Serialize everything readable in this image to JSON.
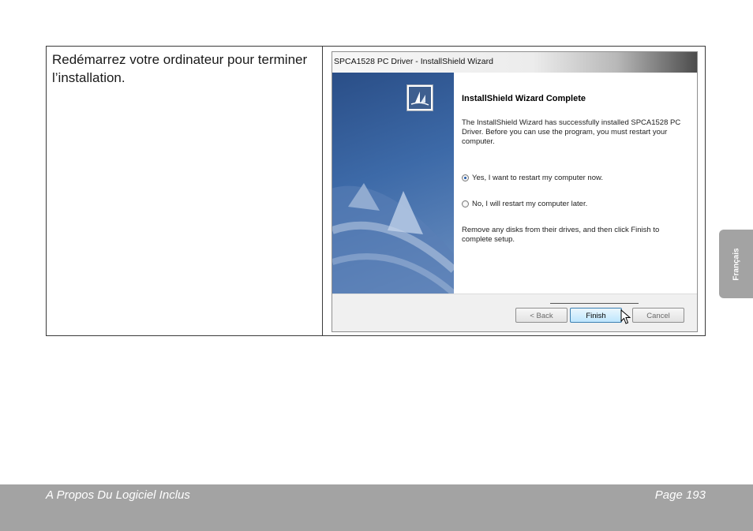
{
  "instruction": {
    "text": "Redémarrez votre ordinateur pour terminer l’installation."
  },
  "wizard": {
    "title": "SPCA1528 PC Driver - InstallShield Wizard",
    "heading": "InstallShield Wizard Complete",
    "body": "The InstallShield Wizard has successfully installed SPCA1528 PC Driver.  Before you can use the program, you must restart your computer.",
    "options": [
      {
        "label": "Yes, I want to restart my computer now.",
        "checked": true
      },
      {
        "label": "No, I will restart my computer later.",
        "checked": false
      }
    ],
    "remove_text": "Remove any disks from their drives, and then click Finish to complete setup.",
    "buttons": {
      "back": "< Back",
      "finish": "Finish",
      "cancel": "Cancel"
    },
    "icons": {
      "logo": "installshield-logo-icon",
      "cursor": "mouse-pointer-icon"
    },
    "colors": {
      "banner": "#2a4e87",
      "finish_border": "#3c7fb1",
      "radio_dot": "#1e57a8"
    }
  },
  "side_tab": {
    "label": "Français"
  },
  "footer": {
    "section": "A Propos Du Logiciel Inclus",
    "page": "Page 193"
  }
}
